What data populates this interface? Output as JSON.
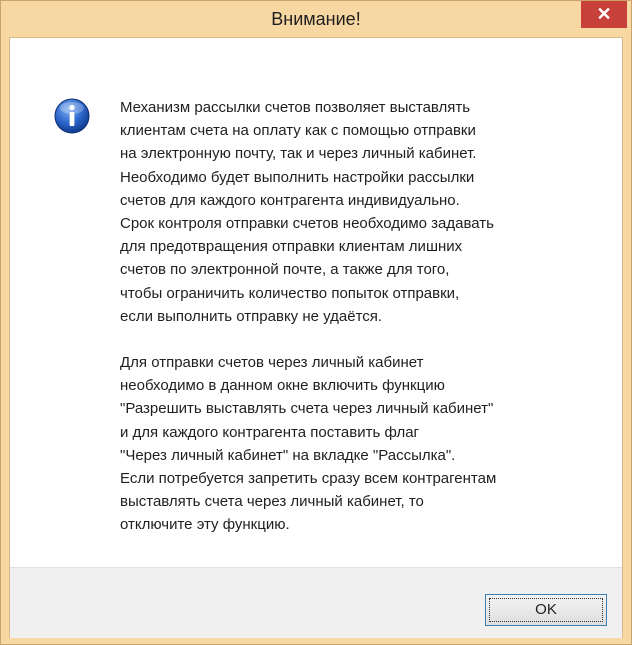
{
  "window": {
    "title": "Внимание!",
    "close_label": "✕"
  },
  "message": {
    "icon": "info-icon",
    "paragraphs": [
      [
        "Механизм рассылки счетов позволяет выставлять",
        "клиентам счета на оплату как с помощью отправки",
        "на электронную почту, так и через личный кабинет.",
        "Необходимо будет выполнить настройки рассылки",
        "счетов для каждого контрагента индивидуально.",
        "Срок контроля отправки счетов необходимо задавать",
        "для предотвращения отправки клиентам лишних",
        "счетов по электронной почте, а также для того,",
        "чтобы ограничить количество попыток отправки,",
        "если выполнить отправку не удаётся."
      ],
      [
        "Для отправки счетов через личный кабинет",
        "необходимо в данном окне включить функцию",
        "\"Разрешить выставлять счета через личный кабинет\"",
        "и для каждого контрагента поставить флаг",
        "\"Через личный кабинет\" на вкладке \"Рассылка\".",
        "Если потребуется запретить сразу всем контрагентам",
        "выставлять счета через личный кабинет, то",
        "отключите эту функцию."
      ]
    ]
  },
  "buttons": {
    "ok_label": "OK"
  },
  "colors": {
    "titlebar": "#f7d7a2",
    "close_button": "#c7403a",
    "footer": "#f0f0f0",
    "button_border": "#3c7fb1"
  }
}
